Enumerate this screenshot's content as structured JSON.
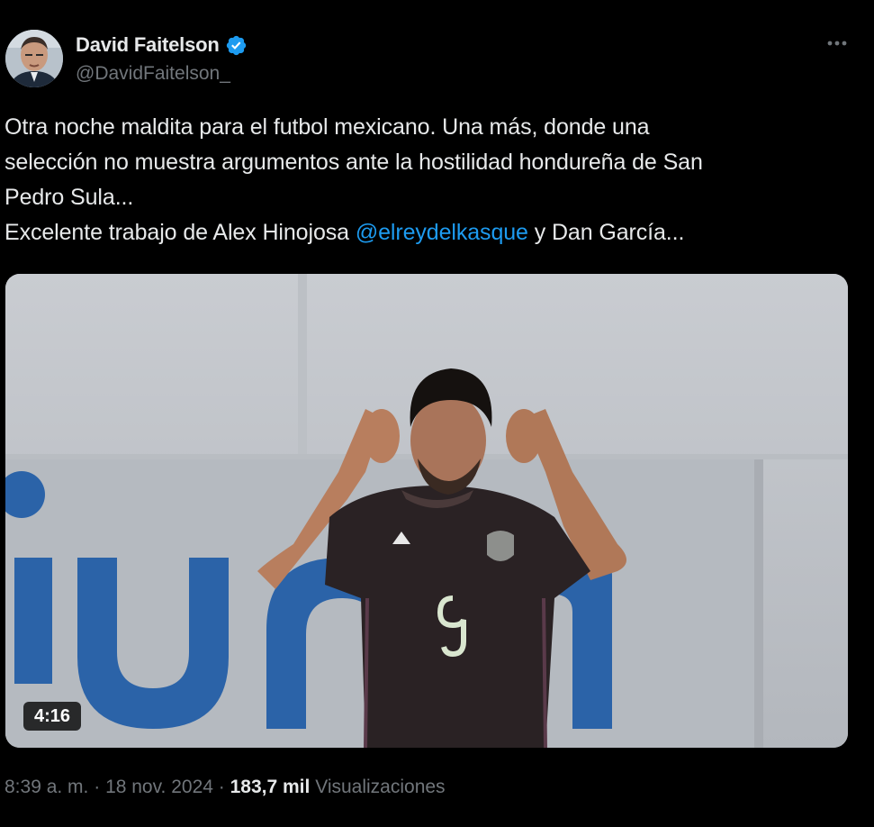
{
  "author": {
    "name": "David Faitelson",
    "handle": "@DavidFaitelson_"
  },
  "tweet": {
    "line1": "Otra noche maldita para el futbol mexicano. Una más, donde una",
    "line2": "selección no muestra argumentos ante la hostilidad hondureña de San",
    "line3": "Pedro Sula...",
    "line4_prefix": "Excelente trabajo de Alex Hinojosa ",
    "line4_mention": "@elreydelkasque",
    "line4_suffix": " y Dan García..."
  },
  "media": {
    "duration": "4:16"
  },
  "meta": {
    "time": "8:39 a. m.",
    "separator1": " · ",
    "date": "18 nov. 2024",
    "separator2": " · ",
    "views_count": "183,7 mil",
    "views_label": " Visualizaciones"
  },
  "colors": {
    "background": "#000000",
    "text": "#e7e9ea",
    "muted": "#71767b",
    "link": "#1d9bf0",
    "verified": "#1d9bf0"
  },
  "icons": {
    "verified": "verified-badge-icon",
    "more": "more-options-icon"
  }
}
